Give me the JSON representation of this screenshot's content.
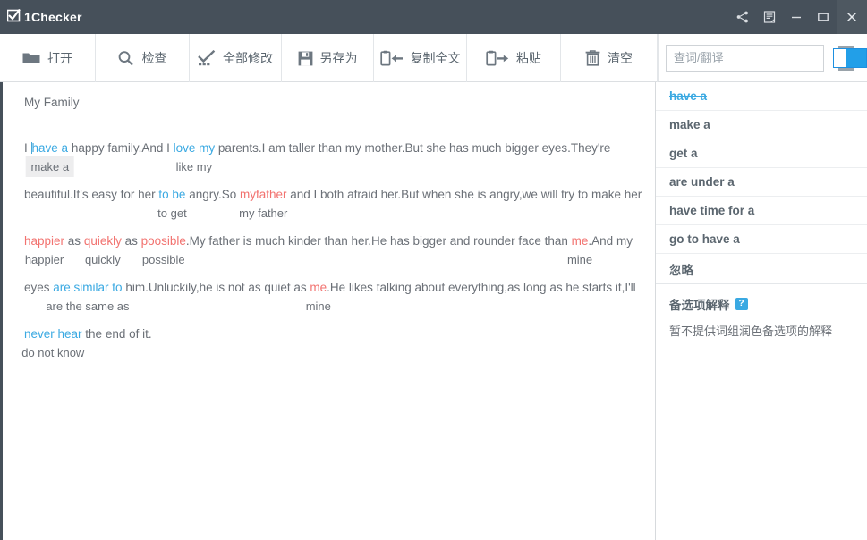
{
  "titlebar": {
    "app_name": "1Checker",
    "brand_icon": "checkbox-check-icon",
    "buttons": [
      {
        "name": "share-icon",
        "label": ""
      },
      {
        "name": "feedback-icon",
        "label": ""
      },
      {
        "name": "minimize-icon",
        "label": ""
      },
      {
        "name": "maximize-icon",
        "label": ""
      },
      {
        "name": "close-icon",
        "label": ""
      }
    ]
  },
  "toolbar": {
    "open_label": "打开",
    "check_label": "检查",
    "fix_all_label": "全部修改",
    "save_as_label": "另存为",
    "copy_all_label": "复制全文",
    "paste_label": "粘贴",
    "clear_label": "清空",
    "search_placeholder": "查词/翻译",
    "search_value": "",
    "toggle_state": "on",
    "accent_color": "#229fe8"
  },
  "editor": {
    "doc_title": "My Family",
    "lines": [
      {
        "segments": [
          {
            "text": "I ",
            "type": "plain"
          },
          {
            "text": "have a",
            "type": "blue",
            "suggestion": "make a",
            "boxed": true
          },
          {
            "text": " happy family.And I ",
            "type": "plain"
          },
          {
            "text": "love my",
            "type": "blue",
            "suggestion": "like my"
          },
          {
            "text": " parents.I am taller than my mother.But she has much bigger eyes.They're",
            "type": "plain"
          }
        ]
      },
      {
        "segments": [
          {
            "text": "beautiful.It's easy for her ",
            "type": "plain"
          },
          {
            "text": "to be",
            "type": "blue",
            "suggestion": "to get"
          },
          {
            "text": " angry.So ",
            "type": "plain"
          },
          {
            "text": "myfather",
            "type": "red",
            "suggestion": "my father"
          },
          {
            "text": " and I both afraid her.But when she is angry,we will try to make her",
            "type": "plain"
          }
        ]
      },
      {
        "segments": [
          {
            "text": "happier",
            "type": "red",
            "suggestion": "happier"
          },
          {
            "text": " as ",
            "type": "plain"
          },
          {
            "text": "quiekly",
            "type": "red",
            "suggestion": "quickly"
          },
          {
            "text": " as ",
            "type": "plain"
          },
          {
            "text": "poosible",
            "type": "red",
            "suggestion": "possible"
          },
          {
            "text": ".My father is much kinder than her.He has bigger and rounder face than ",
            "type": "plain"
          },
          {
            "text": "me",
            "type": "red",
            "suggestion": "mine"
          },
          {
            "text": ".And my",
            "type": "plain"
          }
        ]
      },
      {
        "segments": [
          {
            "text": "eyes ",
            "type": "plain"
          },
          {
            "text": "are similar to",
            "type": "blue",
            "suggestion": "are the same as"
          },
          {
            "text": " him.Unluckily,he is not as quiet as ",
            "type": "plain"
          },
          {
            "text": "me",
            "type": "red",
            "suggestion": "mine"
          },
          {
            "text": ".He likes talking about everything,as long as he starts it,I'll",
            "type": "plain"
          }
        ]
      },
      {
        "segments": [
          {
            "text": "never hear",
            "type": "blue",
            "suggestion": "do not know"
          },
          {
            "text": " the end of it.",
            "type": "plain"
          }
        ]
      }
    ]
  },
  "side_panel": {
    "suggestions": [
      {
        "label": "have a",
        "state": "current"
      },
      {
        "label": "make a",
        "state": "option"
      },
      {
        "label": "get a",
        "state": "option"
      },
      {
        "label": "are under a",
        "state": "option"
      },
      {
        "label": "have time for a",
        "state": "option"
      },
      {
        "label": "go to have a",
        "state": "option"
      }
    ],
    "ignore_label": "忽略",
    "explanation_title": "备选项解释",
    "explanation_badge": "?",
    "explanation_body": "暂不提供词组润色备选项的解释"
  }
}
